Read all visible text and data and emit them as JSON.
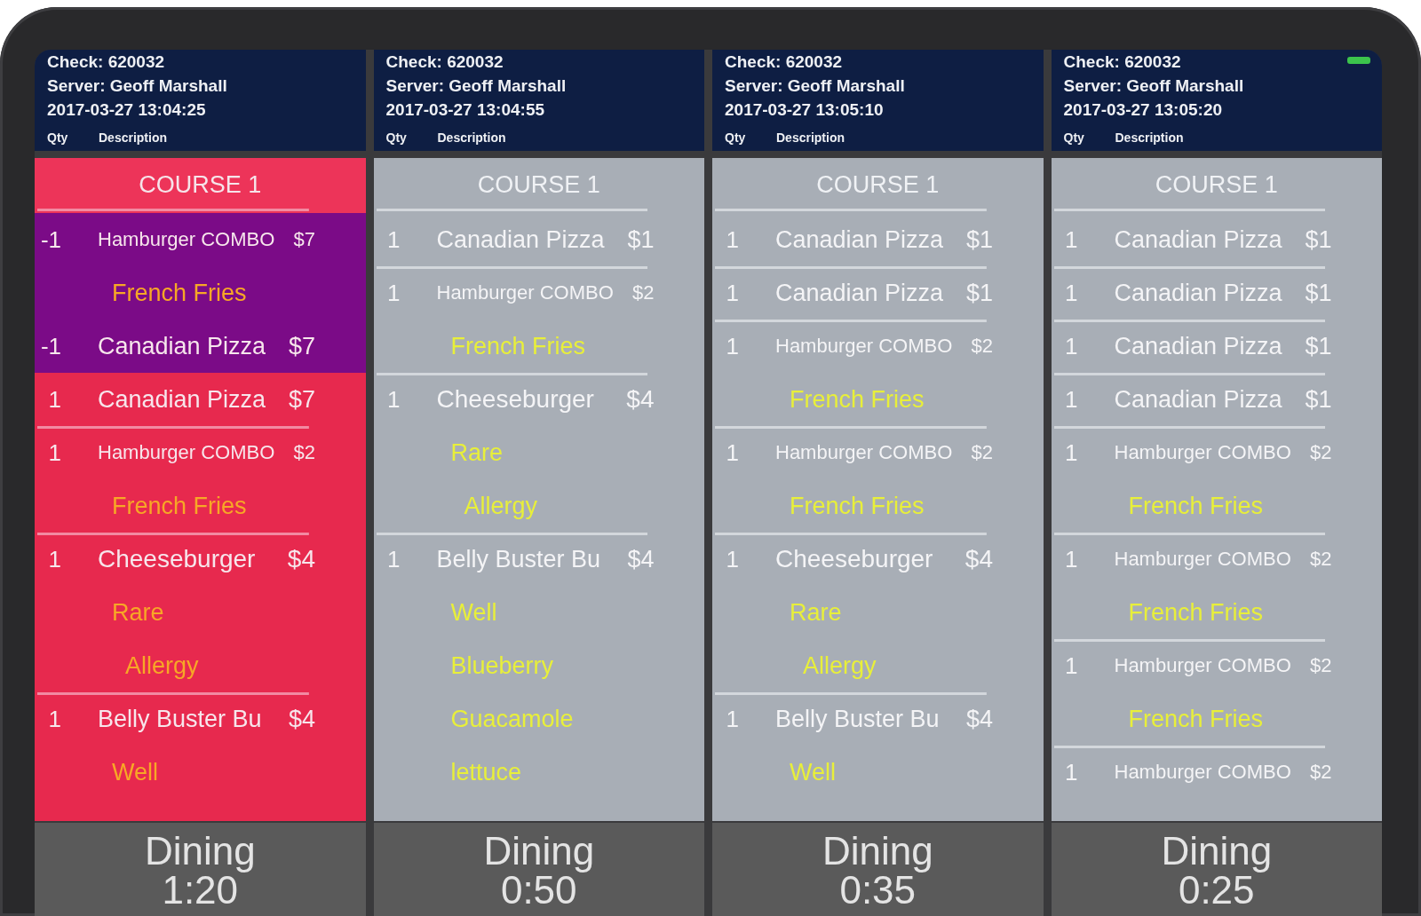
{
  "tickets": [
    {
      "check": "Check: 620032",
      "server": "Server: Geoff Marshall",
      "timestamp": "2017-03-27 13:04:25",
      "qty_label": "Qty",
      "description_label": "Description",
      "alert": true,
      "course": "COURSE 1",
      "items": [
        {
          "qty": "-1",
          "name": "Hamburger COMBO",
          "price": "$7",
          "voided": true,
          "modifiers": [
            {
              "text": "French Fries",
              "kind": "option"
            }
          ]
        },
        {
          "qty": "-1",
          "name": "Canadian Pizza",
          "price": "$7",
          "voided": true
        },
        {
          "qty": "1",
          "name": "Canadian Pizza",
          "price": "$7",
          "voided": false
        },
        {
          "qty": "1",
          "name": "Hamburger COMBO",
          "price": "$2",
          "voided": false,
          "modifiers": [
            {
              "text": "French Fries",
              "kind": "option"
            }
          ]
        },
        {
          "qty": "1",
          "name": "Cheeseburger",
          "price": "$4",
          "voided": false,
          "modifiers": [
            {
              "text": "Rare",
              "kind": "option"
            },
            {
              "text": "Allergy",
              "kind": "note"
            }
          ]
        },
        {
          "qty": "1",
          "name": "Belly Buster Bu",
          "price": "$4",
          "voided": false,
          "modifiers": [
            {
              "text": "Well",
              "kind": "option"
            }
          ]
        }
      ],
      "order_type": "Dining",
      "elapsed": "1:20"
    },
    {
      "check": "Check: 620032",
      "server": "Server: Geoff Marshall",
      "timestamp": "2017-03-27 13:04:55",
      "qty_label": "Qty",
      "description_label": "Description",
      "alert": false,
      "course": "COURSE 1",
      "items": [
        {
          "qty": "1",
          "name": "Canadian Pizza",
          "price": "$1",
          "voided": false
        },
        {
          "qty": "1",
          "name": "Hamburger COMBO",
          "price": "$2",
          "voided": false,
          "modifiers": [
            {
              "text": "French Fries",
              "kind": "option"
            }
          ]
        },
        {
          "qty": "1",
          "name": "Cheeseburger",
          "price": "$4",
          "voided": false,
          "modifiers": [
            {
              "text": "Rare",
              "kind": "option"
            },
            {
              "text": "Allergy",
              "kind": "note"
            }
          ]
        },
        {
          "qty": "1",
          "name": "Belly Buster Bu",
          "price": "$4",
          "voided": false,
          "modifiers": [
            {
              "text": "Well",
              "kind": "option"
            },
            {
              "text": "Blueberry",
              "kind": "option"
            },
            {
              "text": "Guacamole",
              "kind": "option"
            },
            {
              "text": "lettuce",
              "kind": "option"
            }
          ]
        }
      ],
      "order_type": "Dining",
      "elapsed": "0:50"
    },
    {
      "check": "Check: 620032",
      "server": "Server: Geoff Marshall",
      "timestamp": "2017-03-27 13:05:10",
      "qty_label": "Qty",
      "description_label": "Description",
      "alert": false,
      "course": "COURSE 1",
      "items": [
        {
          "qty": "1",
          "name": "Canadian Pizza",
          "price": "$1",
          "voided": false
        },
        {
          "qty": "1",
          "name": "Canadian Pizza",
          "price": "$1",
          "voided": false
        },
        {
          "qty": "1",
          "name": "Hamburger COMBO",
          "price": "$2",
          "voided": false,
          "modifiers": [
            {
              "text": "French Fries",
              "kind": "option"
            }
          ]
        },
        {
          "qty": "1",
          "name": "Hamburger COMBO",
          "price": "$2",
          "voided": false,
          "modifiers": [
            {
              "text": "French Fries",
              "kind": "option"
            }
          ]
        },
        {
          "qty": "1",
          "name": "Cheeseburger",
          "price": "$4",
          "voided": false,
          "modifiers": [
            {
              "text": "Rare",
              "kind": "option"
            },
            {
              "text": "Allergy",
              "kind": "note"
            }
          ]
        },
        {
          "qty": "1",
          "name": "Belly Buster Bu",
          "price": "$4",
          "voided": false,
          "modifiers": [
            {
              "text": "Well",
              "kind": "option"
            }
          ]
        }
      ],
      "order_type": "Dining",
      "elapsed": "0:35"
    },
    {
      "check": "Check: 620032",
      "server": "Server: Geoff Marshall",
      "timestamp": "2017-03-27 13:05:20",
      "qty_label": "Qty",
      "description_label": "Description",
      "alert": false,
      "course": "COURSE 1",
      "items": [
        {
          "qty": "1",
          "name": "Canadian Pizza",
          "price": "$1",
          "voided": false
        },
        {
          "qty": "1",
          "name": "Canadian Pizza",
          "price": "$1",
          "voided": false
        },
        {
          "qty": "1",
          "name": "Canadian Pizza",
          "price": "$1",
          "voided": false
        },
        {
          "qty": "1",
          "name": "Canadian Pizza",
          "price": "$1",
          "voided": false
        },
        {
          "qty": "1",
          "name": "Hamburger COMBO",
          "price": "$2",
          "voided": false,
          "modifiers": [
            {
              "text": "French Fries",
              "kind": "option"
            }
          ]
        },
        {
          "qty": "1",
          "name": "Hamburger COMBO",
          "price": "$2",
          "voided": false,
          "modifiers": [
            {
              "text": "French Fries",
              "kind": "option"
            }
          ]
        },
        {
          "qty": "1",
          "name": "Hamburger COMBO",
          "price": "$2",
          "voided": false,
          "modifiers": [
            {
              "text": "French Fries",
              "kind": "option"
            }
          ]
        },
        {
          "qty": "1",
          "name": "Hamburger COMBO",
          "price": "$2",
          "voided": false
        }
      ],
      "order_type": "Dining",
      "elapsed": "0:25"
    }
  ]
}
